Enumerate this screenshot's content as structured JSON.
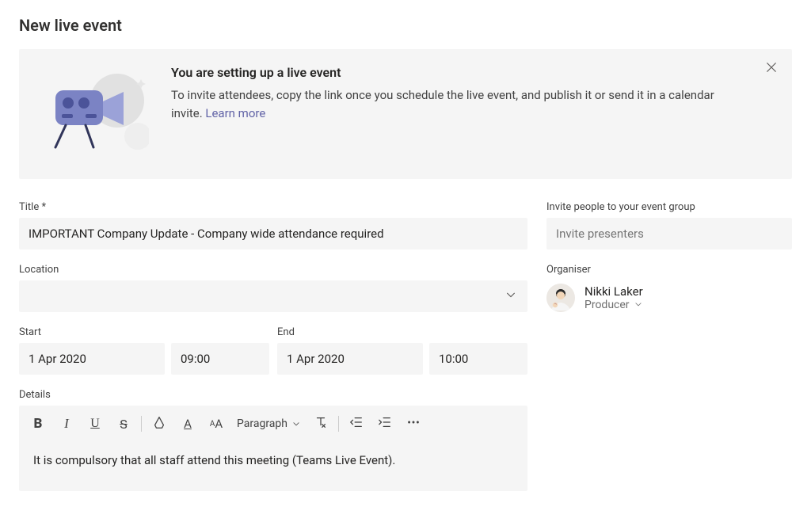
{
  "pageTitle": "New live event",
  "banner": {
    "heading": "You are setting up a live event",
    "body": "To invite attendees, copy the link once you schedule the live event, and publish it or send it in a calendar invite. ",
    "learnMore": "Learn more"
  },
  "fields": {
    "titleLabel": "Title *",
    "titleValue": "IMPORTANT Company Update - Company wide attendance required",
    "locationLabel": "Location",
    "locationValue": "",
    "startLabel": "Start",
    "startDate": "1 Apr 2020",
    "startTime": "09:00",
    "endLabel": "End",
    "endDate": "1 Apr 2020",
    "endTime": "10:00",
    "detailsLabel": "Details",
    "detailsBody": "It is compulsory that all staff attend this meeting (Teams Live Event)."
  },
  "editor": {
    "paragraphLabel": "Paragraph"
  },
  "invite": {
    "label": "Invite people to your event group",
    "placeholder": "Invite presenters"
  },
  "organiser": {
    "heading": "Organiser",
    "name": "Nikki Laker",
    "role": "Producer"
  }
}
